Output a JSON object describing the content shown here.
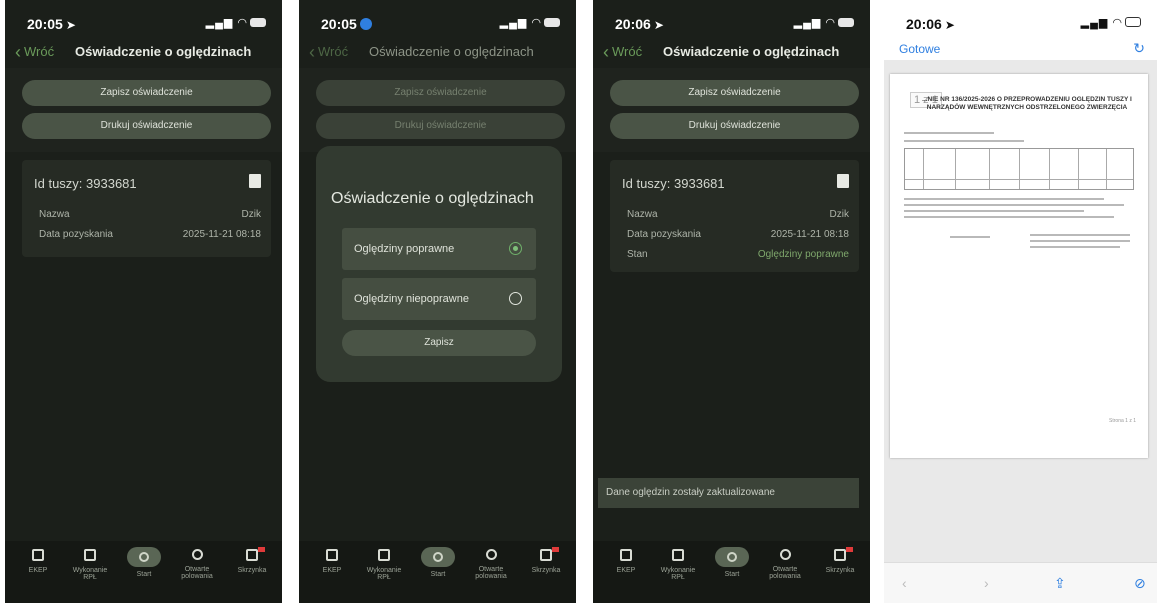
{
  "screen1": {
    "time": "20:05",
    "back": "Wróć",
    "title": "Oświadczenie o oględzinach",
    "save_button": "Zapisz oświadczenie",
    "print_button": "Drukuj oświadczenie",
    "carcass_id": "Id tuszy: 3933681",
    "rows": [
      {
        "label": "Nazwa",
        "value": "Dzik"
      },
      {
        "label": "Data pozyskania",
        "value": "2025-11-21 08:18"
      }
    ]
  },
  "screen2": {
    "time": "20:05",
    "back": "Wróć",
    "title": "Oświadczenie o oględzinach",
    "save_button": "Zapisz oświadczenie",
    "print_button": "Drukuj oświadczenie",
    "modal": {
      "title": "Oświadczenie o oględzinach",
      "option_correct": "Oględziny poprawne",
      "option_incorrect": "Oględziny niepoprawne",
      "selected": "Oględziny poprawne",
      "save": "Zapisz"
    }
  },
  "screen3": {
    "time": "20:06",
    "back": "Wróć",
    "title": "Oświadczenie o oględzinach",
    "save_button": "Zapisz oświadczenie",
    "print_button": "Drukuj oświadczenie",
    "carcass_id": "Id tuszy: 3933681",
    "rows": [
      {
        "label": "Nazwa",
        "value": "Dzik"
      },
      {
        "label": "Data pozyskania",
        "value": "2025-11-21 08:18"
      },
      {
        "label": "Stan",
        "value": "Oględziny poprawne"
      }
    ],
    "toast": "Dane oględzin zostały zaktualizowane"
  },
  "screen4": {
    "time": "20:06",
    "done": "Gotowe",
    "page_indicator": "1 z 1",
    "doc_title": "...NIE NR 136/2025-2026 O PRZEPROWADZENIU OGLĘDZIN TUSZY I NARZĄDÓW WEWNĘTRZNYCH ODSTRZELONEGO ZWIERZĘCIA",
    "page_footer": "Strona 1 z 1"
  },
  "tabs": [
    {
      "label": "EKEP",
      "icon": "book-icon"
    },
    {
      "label": "Wykonanie RPŁ",
      "icon": "calendar-icon"
    },
    {
      "label": "Start",
      "icon": "start-icon"
    },
    {
      "label": "Otwarte polowania",
      "icon": "crosshair-icon"
    },
    {
      "label": "Skrzynka",
      "icon": "inbox-icon"
    }
  ],
  "colors": {
    "background": "#1b1f1a",
    "accent_green": "#7fa86c",
    "button": "#4a5446",
    "link_blue": "#2f7fe0",
    "badge_red": "#e03a3a"
  }
}
